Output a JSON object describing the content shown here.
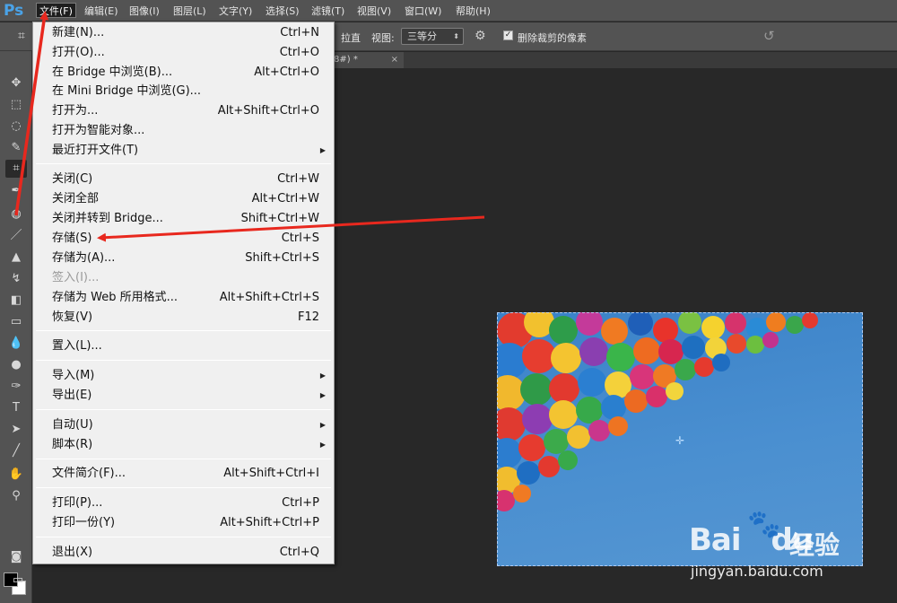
{
  "app": {
    "logo": "Ps"
  },
  "menubar": [
    {
      "label": "文件(F)",
      "active": true
    },
    {
      "label": "编辑(E)"
    },
    {
      "label": "图像(I)"
    },
    {
      "label": "图层(L)"
    },
    {
      "label": "文字(Y)"
    },
    {
      "label": "选择(S)"
    },
    {
      "label": "滤镜(T)"
    },
    {
      "label": "视图(V)"
    },
    {
      "label": "窗口(W)"
    },
    {
      "label": "帮助(H)"
    }
  ],
  "options": {
    "straighten_label": "拉直",
    "view_label": "视图:",
    "view_value": "三等分",
    "delete_cropped_label": "删除裁剪的像素",
    "delete_cropped_checked": true
  },
  "document_tab": {
    "label": "8#) *",
    "close": "×"
  },
  "file_menu": [
    {
      "label": "新建(N)...",
      "shortcut": "Ctrl+N"
    },
    {
      "label": "打开(O)...",
      "shortcut": "Ctrl+O"
    },
    {
      "label": "在 Bridge 中浏览(B)...",
      "shortcut": "Alt+Ctrl+O"
    },
    {
      "label": "在 Mini Bridge 中浏览(G)...",
      "shortcut": ""
    },
    {
      "label": "打开为...",
      "shortcut": "Alt+Shift+Ctrl+O"
    },
    {
      "label": "打开为智能对象...",
      "shortcut": ""
    },
    {
      "label": "最近打开文件(T)",
      "shortcut": "",
      "submenu": true
    },
    {
      "label": "关闭(C)",
      "shortcut": "Ctrl+W"
    },
    {
      "label": "关闭全部",
      "shortcut": "Alt+Ctrl+W"
    },
    {
      "label": "关闭并转到 Bridge...",
      "shortcut": "Shift+Ctrl+W"
    },
    {
      "label": "存储(S)",
      "shortcut": "Ctrl+S"
    },
    {
      "label": "存储为(A)...",
      "shortcut": "Shift+Ctrl+S"
    },
    {
      "label": "签入(I)...",
      "shortcut": "",
      "disabled": true
    },
    {
      "label": "存储为 Web 所用格式...",
      "shortcut": "Alt+Shift+Ctrl+S"
    },
    {
      "label": "恢复(V)",
      "shortcut": "F12"
    },
    {
      "label": "置入(L)...",
      "shortcut": ""
    },
    {
      "label": "导入(M)",
      "shortcut": "",
      "submenu": true
    },
    {
      "label": "导出(E)",
      "shortcut": "",
      "submenu": true
    },
    {
      "label": "自动(U)",
      "shortcut": "",
      "submenu": true
    },
    {
      "label": "脚本(R)",
      "shortcut": "",
      "submenu": true
    },
    {
      "label": "文件简介(F)...",
      "shortcut": "Alt+Shift+Ctrl+I"
    },
    {
      "label": "打印(P)...",
      "shortcut": "Ctrl+P"
    },
    {
      "label": "打印一份(Y)",
      "shortcut": "Alt+Shift+Ctrl+P"
    },
    {
      "label": "退出(X)",
      "shortcut": "Ctrl+Q"
    }
  ],
  "submenu_glyph": "▶",
  "watermark": {
    "logo_left": "Bai",
    "logo_right": "du",
    "cn": "经验",
    "url": "jingyan.baidu.com"
  },
  "colors": {
    "annotation": "#e8281e",
    "foreground": "#000000",
    "background": "#ffffff"
  }
}
